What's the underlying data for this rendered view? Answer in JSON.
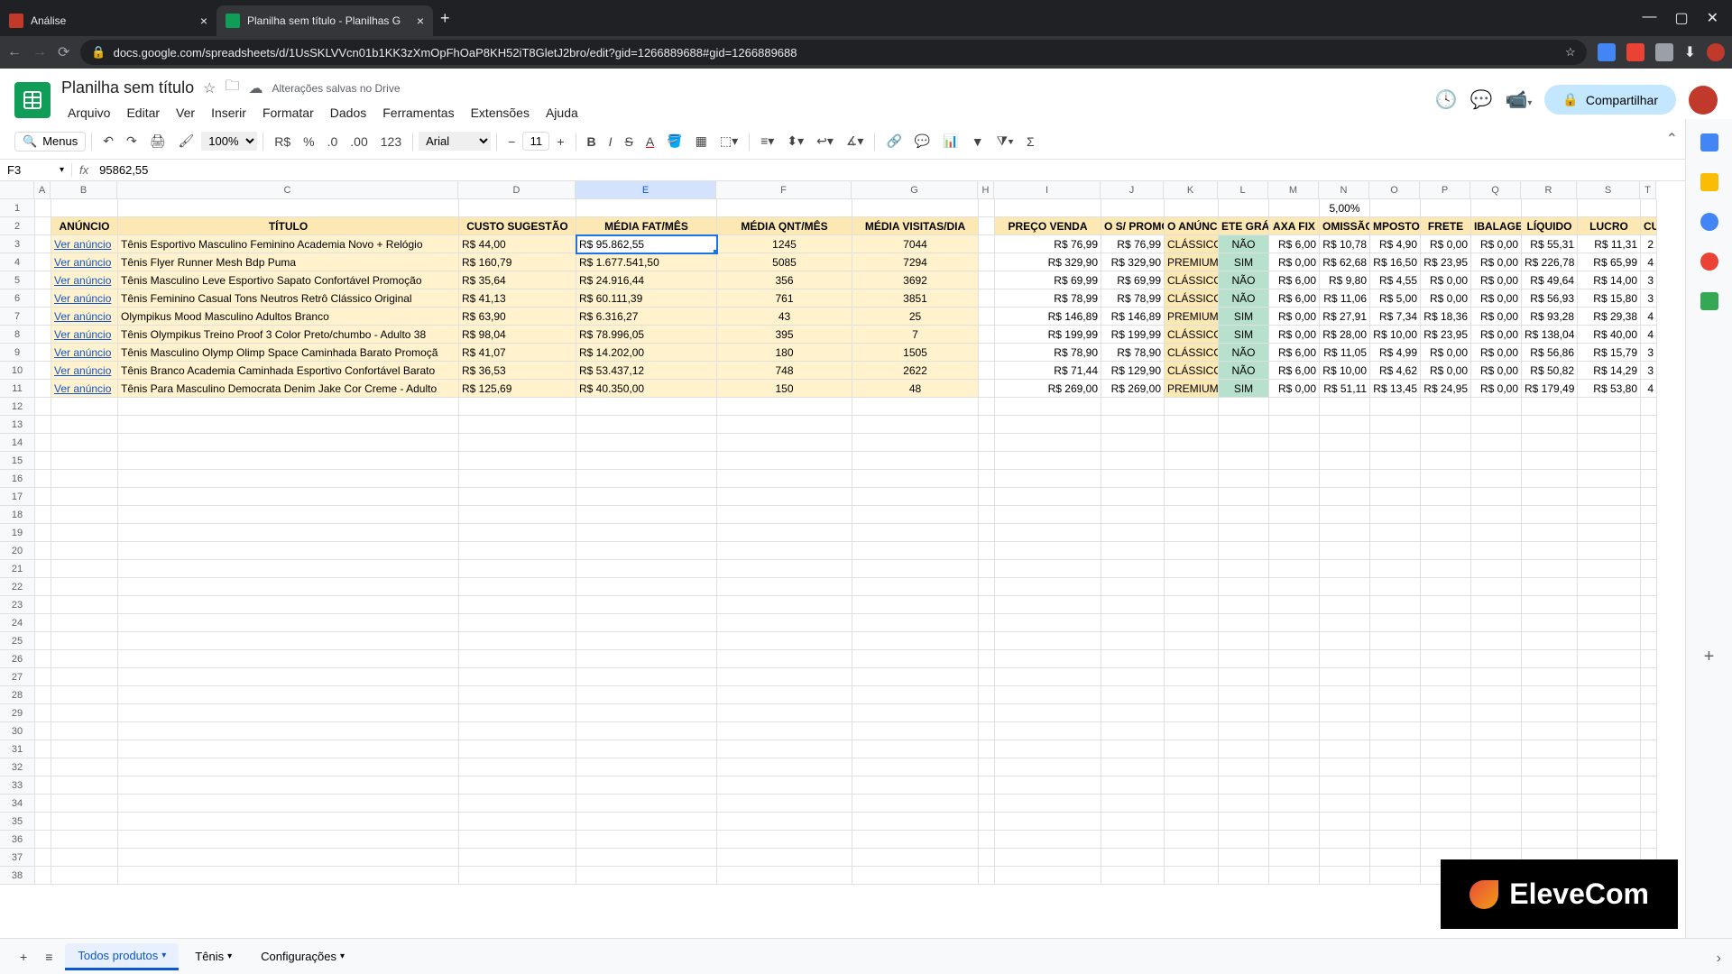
{
  "browser": {
    "tabs": [
      {
        "title": "Análise",
        "active": false
      },
      {
        "title": "Planilha sem título - Planilhas G",
        "active": true
      }
    ],
    "url": "docs.google.com/spreadsheets/d/1UsSKLVVcn01b1KK3zXmOpFhOaP8KH52iT8GletJ2bro/edit?gid=1266889688#gid=1266889688"
  },
  "doc": {
    "title": "Planilha sem título",
    "save_status": "Alterações salvas no Drive",
    "menus": [
      "Arquivo",
      "Editar",
      "Ver",
      "Inserir",
      "Formatar",
      "Dados",
      "Ferramentas",
      "Extensões",
      "Ajuda"
    ],
    "share_label": "Compartilhar"
  },
  "toolbar": {
    "search_placeholder": "Menus",
    "zoom": "100%",
    "font": "Arial",
    "font_size": "11"
  },
  "formula": {
    "cell_ref": "F3",
    "value": "95862,55"
  },
  "columns": [
    "A",
    "B",
    "C",
    "D",
    "E",
    "F",
    "G",
    "H",
    "I",
    "J",
    "K",
    "L",
    "M",
    "N",
    "O",
    "P",
    "Q",
    "R",
    "S",
    "T"
  ],
  "col_widths": [
    "w-a",
    "w-b",
    "w-c",
    "w-d",
    "w-e",
    "w-f",
    "w-g",
    "w-h",
    "w-i",
    "w-j",
    "w-k",
    "w-l",
    "w-m",
    "w-n",
    "w-o",
    "w-p",
    "w-q",
    "w-r",
    "w-s",
    "w-t"
  ],
  "selected_col_index": 4,
  "headers_row2": {
    "B": "ANÚNCIO",
    "C": "TÍTULO",
    "D": "CUSTO SUGESTÃO",
    "E": "MÉDIA FAT/MÊS",
    "F": "MÉDIA QNT/MÊS",
    "G": "MÉDIA VISITAS/DIA",
    "I": "PREÇO VENDA",
    "J": "O S/ PROMO",
    "K": "O ANÚNCI",
    "L": "ETE GRÁT",
    "M": "AXA FIX",
    "N": "OMISSÃO",
    "O": "MPOSTO",
    "P": "FRETE",
    "Q": "IBALAGE",
    "R": "LÍQUIDO",
    "S": "LUCRO",
    "T": "CU"
  },
  "row1_n": "5,00%",
  "data_rows": [
    {
      "B": "Ver anúncio",
      "C": "Tênis Esportivo Masculino Feminino Academia Novo + Relógio",
      "D": "R$ 44,00",
      "E": "R$ 95.862,55",
      "F": "1245",
      "G": "7044",
      "I": "R$ 76,99",
      "J": "R$ 76,99",
      "K": "CLÁSSICO",
      "L": "NÃO",
      "M": "R$ 6,00",
      "N": "R$ 10,78",
      "O": "R$ 4,90",
      "P": "R$ 0,00",
      "Q": "R$ 0,00",
      "R": "R$ 55,31",
      "S": "R$ 11,31",
      "T": "2"
    },
    {
      "B": "Ver anúncio",
      "C": "Tênis Flyer Runner Mesh Bdp Puma",
      "D": "R$ 160,79",
      "E": "R$ 1.677.541,50",
      "F": "5085",
      "G": "7294",
      "I": "R$ 329,90",
      "J": "R$ 329,90",
      "K": "PREMIUM",
      "L": "SIM",
      "M": "R$ 0,00",
      "N": "R$ 62,68",
      "O": "R$ 16,50",
      "P": "R$ 23,95",
      "Q": "R$ 0,00",
      "R": "R$ 226,78",
      "S": "R$ 65,99",
      "T": "4"
    },
    {
      "B": "Ver anúncio",
      "C": "Tênis Masculino Leve Esportivo Sapato Confortável Promoção",
      "D": "R$ 35,64",
      "E": "R$ 24.916,44",
      "F": "356",
      "G": "3692",
      "I": "R$ 69,99",
      "J": "R$ 69,99",
      "K": "CLÁSSICO",
      "L": "NÃO",
      "M": "R$ 6,00",
      "N": "R$ 9,80",
      "O": "R$ 4,55",
      "P": "R$ 0,00",
      "Q": "R$ 0,00",
      "R": "R$ 49,64",
      "S": "R$ 14,00",
      "T": "3"
    },
    {
      "B": "Ver anúncio",
      "C": "Tênis Feminino Casual Tons Neutros Retrô Clássico Original",
      "D": "R$ 41,13",
      "E": "R$ 60.111,39",
      "F": "761",
      "G": "3851",
      "I": "R$ 78,99",
      "J": "R$ 78,99",
      "K": "CLÁSSICO",
      "L": "NÃO",
      "M": "R$ 6,00",
      "N": "R$ 11,06",
      "O": "R$ 5,00",
      "P": "R$ 0,00",
      "Q": "R$ 0,00",
      "R": "R$ 56,93",
      "S": "R$ 15,80",
      "T": "3"
    },
    {
      "B": "Ver anúncio",
      "C": "Olympikus Mood Masculino Adultos Branco",
      "D": "R$ 63,90",
      "E": "R$ 6.316,27",
      "F": "43",
      "G": "25",
      "I": "R$ 146,89",
      "J": "R$ 146,89",
      "K": "PREMIUM",
      "L": "SIM",
      "M": "R$ 0,00",
      "N": "R$ 27,91",
      "O": "R$ 7,34",
      "P": "R$ 18,36",
      "Q": "R$ 0,00",
      "R": "R$ 93,28",
      "S": "R$ 29,38",
      "T": "4"
    },
    {
      "B": "Ver anúncio",
      "C": "Tênis Olympikus Treino Proof 3 Color Preto/chumbo - Adulto 38",
      "D": "R$ 98,04",
      "E": "R$ 78.996,05",
      "F": "395",
      "G": "7",
      "I": "R$ 199,99",
      "J": "R$ 199,99",
      "K": "CLÁSSICO",
      "L": "SIM",
      "M": "R$ 0,00",
      "N": "R$ 28,00",
      "O": "R$ 10,00",
      "P": "R$ 23,95",
      "Q": "R$ 0,00",
      "R": "R$ 138,04",
      "S": "R$ 40,00",
      "T": "4"
    },
    {
      "B": "Ver anúncio",
      "C": "Tênis Masculino Olymp Olimp Space Caminhada Barato Promoçã",
      "D": "R$ 41,07",
      "E": "R$ 14.202,00",
      "F": "180",
      "G": "1505",
      "I": "R$ 78,90",
      "J": "R$ 78,90",
      "K": "CLÁSSICO",
      "L": "NÃO",
      "M": "R$ 6,00",
      "N": "R$ 11,05",
      "O": "R$ 4,99",
      "P": "R$ 0,00",
      "Q": "R$ 0,00",
      "R": "R$ 56,86",
      "S": "R$ 15,79",
      "T": "3"
    },
    {
      "B": "Ver anúncio",
      "C": "Tênis Branco Academia Caminhada Esportivo Confortável Barato",
      "D": "R$ 36,53",
      "E": "R$ 53.437,12",
      "F": "748",
      "G": "2622",
      "I": "R$ 71,44",
      "J": "R$ 129,90",
      "K": "CLÁSSICO",
      "L": "NÃO",
      "M": "R$ 6,00",
      "N": "R$ 10,00",
      "O": "R$ 4,62",
      "P": "R$ 0,00",
      "Q": "R$ 0,00",
      "R": "R$ 50,82",
      "S": "R$ 14,29",
      "T": "3"
    },
    {
      "B": "Ver anúncio",
      "C": "Tênis Para Masculino Democrata Denim Jake Cor Creme - Adulto",
      "D": "R$ 125,69",
      "E": "R$ 40.350,00",
      "F": "150",
      "G": "48",
      "I": "R$ 269,00",
      "J": "R$ 269,00",
      "K": "PREMIUM",
      "L": "SIM",
      "M": "R$ 0,00",
      "N": "R$ 51,11",
      "O": "R$ 13,45",
      "P": "R$ 24,95",
      "Q": "R$ 0,00",
      "R": "R$ 179,49",
      "S": "R$ 53,80",
      "T": "4"
    }
  ],
  "selected_cell": {
    "row_index": 0,
    "col": "E"
  },
  "empty_rows_from": 12,
  "empty_rows_to": 38,
  "sheet_tabs": [
    {
      "label": "Todos produtos",
      "active": true
    },
    {
      "label": "Tênis",
      "active": false
    },
    {
      "label": "Configurações",
      "active": false
    }
  ],
  "watermark": "EleveCom"
}
